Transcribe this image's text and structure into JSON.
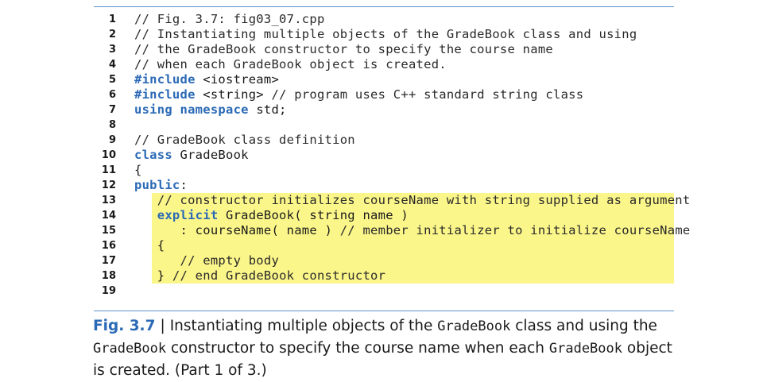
{
  "code_lines": [
    {
      "num": "1",
      "highlight": false,
      "tokens": [
        {
          "t": "// Fig. 3.7: fig03_07.cpp",
          "c": "cm"
        }
      ]
    },
    {
      "num": "2",
      "highlight": false,
      "tokens": [
        {
          "t": "// Instantiating multiple objects of the GradeBook class and using",
          "c": "cm"
        }
      ]
    },
    {
      "num": "3",
      "highlight": false,
      "tokens": [
        {
          "t": "// the GradeBook constructor to specify the course name",
          "c": "cm"
        }
      ]
    },
    {
      "num": "4",
      "highlight": false,
      "tokens": [
        {
          "t": "// when each GradeBook object is created.",
          "c": "cm"
        }
      ]
    },
    {
      "num": "5",
      "highlight": false,
      "tokens": [
        {
          "t": "#include",
          "c": "kw"
        },
        {
          "t": " <iostream>",
          "c": ""
        }
      ]
    },
    {
      "num": "6",
      "highlight": false,
      "tokens": [
        {
          "t": "#include",
          "c": "kw"
        },
        {
          "t": " <string> ",
          "c": ""
        },
        {
          "t": "// program uses C++ standard string class",
          "c": "cm"
        }
      ]
    },
    {
      "num": "7",
      "highlight": false,
      "tokens": [
        {
          "t": "using namespace",
          "c": "kw"
        },
        {
          "t": " std;",
          "c": ""
        }
      ]
    },
    {
      "num": "8",
      "highlight": false,
      "tokens": []
    },
    {
      "num": "9",
      "highlight": false,
      "tokens": [
        {
          "t": "// GradeBook class definition",
          "c": "cm"
        }
      ]
    },
    {
      "num": "10",
      "highlight": false,
      "tokens": [
        {
          "t": "class",
          "c": "kw"
        },
        {
          "t": " GradeBook",
          "c": ""
        }
      ]
    },
    {
      "num": "11",
      "highlight": false,
      "tokens": [
        {
          "t": "{",
          "c": ""
        }
      ]
    },
    {
      "num": "12",
      "highlight": false,
      "tokens": [
        {
          "t": "public",
          "c": "kw"
        },
        {
          "t": ":",
          "c": ""
        }
      ]
    },
    {
      "num": "13",
      "highlight": true,
      "tokens": [
        {
          "t": "   // constructor initializes courseName with string supplied as argument",
          "c": "cm"
        }
      ]
    },
    {
      "num": "14",
      "highlight": true,
      "tokens": [
        {
          "t": "   ",
          "c": ""
        },
        {
          "t": "explicit",
          "c": "kw"
        },
        {
          "t": " GradeBook( string name )",
          "c": ""
        }
      ]
    },
    {
      "num": "15",
      "highlight": true,
      "tokens": [
        {
          "t": "      : courseName( name ) ",
          "c": ""
        },
        {
          "t": "// member initializer to initialize courseName",
          "c": "cm"
        }
      ]
    },
    {
      "num": "16",
      "highlight": true,
      "tokens": [
        {
          "t": "   {",
          "c": ""
        }
      ]
    },
    {
      "num": "17",
      "highlight": true,
      "tokens": [
        {
          "t": "      // empty body",
          "c": "cm"
        }
      ]
    },
    {
      "num": "18",
      "highlight": true,
      "tokens": [
        {
          "t": "   } ",
          "c": ""
        },
        {
          "t": "// end GradeBook constructor",
          "c": "cm"
        }
      ]
    },
    {
      "num": "19",
      "highlight": false,
      "tokens": []
    }
  ],
  "caption": {
    "label": "Fig. 3.7",
    "separator": "|",
    "segments": [
      {
        "t": "Instantiating multiple objects of the ",
        "mono": false
      },
      {
        "t": "GradeBook",
        "mono": true
      },
      {
        "t": " class and using the ",
        "mono": false
      },
      {
        "t": "GradeBook",
        "mono": true
      },
      {
        "t": " constructor to specify the course name when each ",
        "mono": false
      },
      {
        "t": "GradeBook",
        "mono": true
      },
      {
        "t": " object is created. (Part 1 of 3.)",
        "mono": false
      }
    ]
  },
  "colors": {
    "keyword": "#2a69b5",
    "highlight": "#fbf68a",
    "rule": "#5b8fc7"
  }
}
